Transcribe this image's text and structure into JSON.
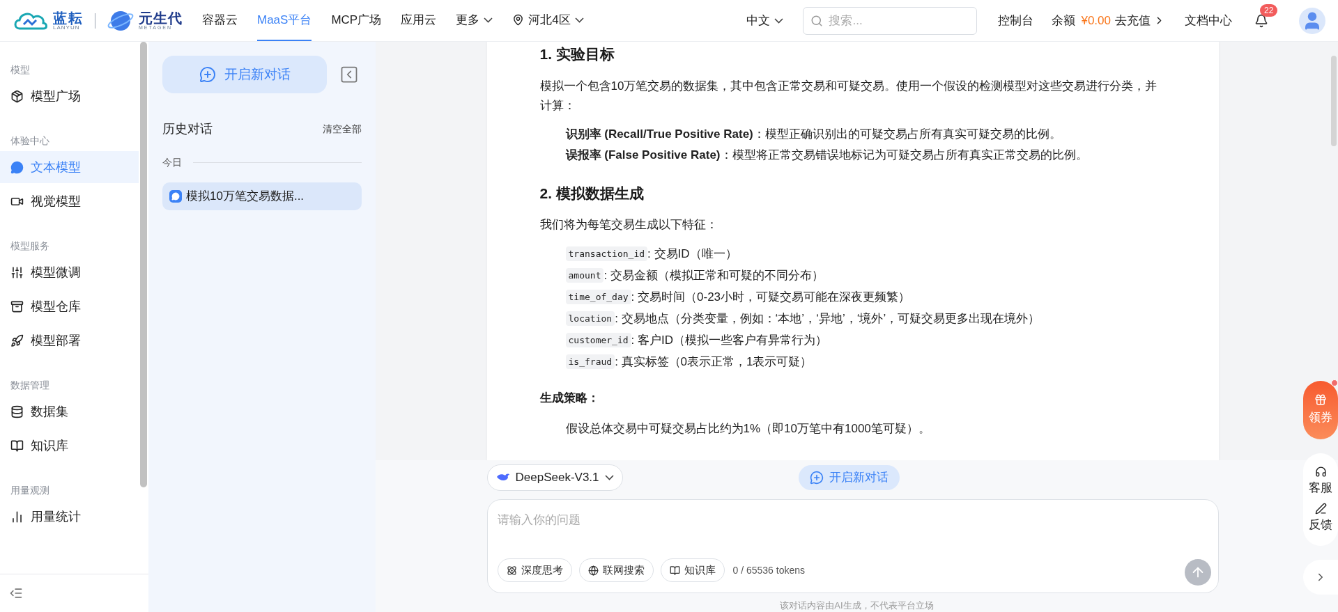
{
  "top_nav": {
    "brand": {
      "name": "蓝耘",
      "sub": "LANYUN"
    },
    "partner": {
      "name": "元生代",
      "sub": "METAGEN"
    },
    "items": [
      {
        "label": "容器云",
        "selected": false,
        "kind": "link"
      },
      {
        "label": "MaaS平台",
        "selected": true,
        "kind": "link"
      },
      {
        "label": "MCP广场",
        "selected": false,
        "kind": "link"
      },
      {
        "label": "应用云",
        "selected": false,
        "kind": "link"
      },
      {
        "label": "更多",
        "selected": false,
        "kind": "dropdown"
      },
      {
        "label": "河北4区",
        "selected": false,
        "kind": "region"
      }
    ],
    "language": "中文",
    "search": {
      "placeholder": "搜索..."
    },
    "console": "控制台",
    "balance": {
      "label": "余额",
      "amount": "¥0.00",
      "recharge": "去充值"
    },
    "docs": "文档中心",
    "notifications": {
      "count": "22"
    }
  },
  "sidebar": {
    "sections": [
      {
        "title": "模型",
        "items": [
          {
            "label": "模型广场",
            "selected": false
          }
        ]
      },
      {
        "title": "体验中心",
        "items": [
          {
            "label": "文本模型",
            "selected": true
          },
          {
            "label": "视觉模型",
            "selected": false
          }
        ]
      },
      {
        "title": "模型服务",
        "items": [
          {
            "label": "模型微调",
            "selected": false
          },
          {
            "label": "模型仓库",
            "selected": false
          },
          {
            "label": "模型部署",
            "selected": false
          }
        ]
      },
      {
        "title": "数据管理",
        "items": [
          {
            "label": "数据集",
            "selected": false
          },
          {
            "label": "知识库",
            "selected": false
          }
        ]
      },
      {
        "title": "用量观测",
        "items": [
          {
            "label": "用量统计",
            "selected": false
          }
        ]
      }
    ]
  },
  "history": {
    "new_chat": "开启新对话",
    "title": "历史对话",
    "clear_all": "清空全部",
    "groups": [
      {
        "label": "今日",
        "items": [
          {
            "title": "模拟10万笔交易数据...",
            "selected": true
          }
        ]
      }
    ]
  },
  "content": [
    {
      "kind": "heading",
      "text": "1. 实验目标"
    },
    {
      "kind": "paragraph",
      "text": "模拟一个包含10万笔交易的数据集，其中包含正常交易和可疑交易。使用一个假设的检测模型对这些交易进行分类，并计算："
    },
    {
      "kind": "item",
      "text": "**识别率 (Recall/True Positive Rate)**：模型正确识别出的可疑交易占所有真实可疑交易的比例。"
    },
    {
      "kind": "item",
      "text": "**误报率 (False Positive Rate)**：模型将正常交易错误地标记为可疑交易占所有真实正常交易的比例。"
    },
    {
      "kind": "heading",
      "text": "2. 模拟数据生成"
    },
    {
      "kind": "paragraph",
      "text": "我们将为每笔交易生成以下特征："
    },
    {
      "kind": "code_item",
      "code": "transaction_id",
      "text": ": 交易ID（唯一）"
    },
    {
      "kind": "code_item",
      "code": "amount",
      "text": ": 交易金额（模拟正常和可疑的不同分布）"
    },
    {
      "kind": "code_item",
      "code": "time_of_day",
      "text": ": 交易时间（0-23小时，可疑交易可能在深夜更频繁）"
    },
    {
      "kind": "code_item",
      "code": "location",
      "text": ": 交易地点（分类变量，例如：‘本地’，‘异地’，‘境外’，可疑交易更多出现在境外）"
    },
    {
      "kind": "code_item",
      "code": "customer_id",
      "text": ": 客户ID（模拟一些客户有异常行为）"
    },
    {
      "kind": "code_item",
      "code": "is_fraud",
      "text": ": 真实标签（0表示正常，1表示可疑）"
    },
    {
      "kind": "label",
      "text": "生成策略："
    },
    {
      "kind": "item",
      "text": "假设总体交易中可疑交易占比约为1%（即10万笔中有1000笔可疑）。"
    }
  ],
  "composer": {
    "model": "DeepSeek-V3.1",
    "new_chat": "开启新对话",
    "placeholder": "请输入你的问题",
    "tools": [
      {
        "label": "深度思考",
        "selected": false
      },
      {
        "label": "联网搜索",
        "selected": false
      },
      {
        "label": "知识库",
        "selected": false
      }
    ],
    "token_count": "0 / 65536 tokens",
    "disclaimer": "该对话内容由AI生成，不代表平台立场"
  },
  "float_actions": [
    {
      "label": "领券",
      "kind": "promo"
    },
    {
      "label": "客服",
      "kind": "service"
    },
    {
      "label": "反馈",
      "kind": "feedback"
    }
  ]
}
